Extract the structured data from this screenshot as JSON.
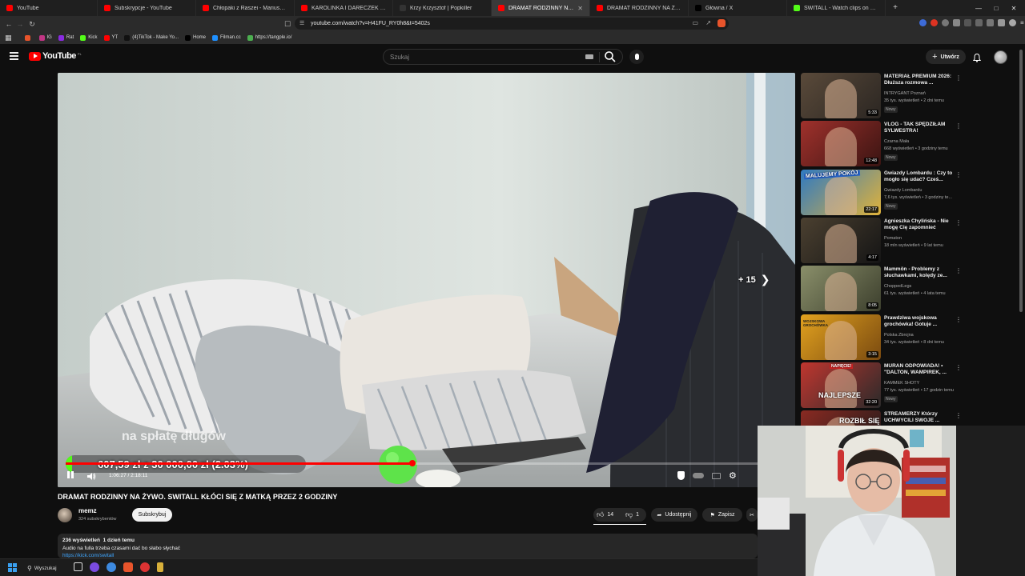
{
  "tabs": [
    {
      "label": "YouTube",
      "color": "#ff0000",
      "active": false
    },
    {
      "label": "Subskrypcje - YouTube",
      "color": "#ff0000",
      "active": false
    },
    {
      "label": "Chłopaki z Raszei - Mariusz wymyśli...",
      "color": "#ff0000",
      "active": false
    },
    {
      "label": "KAROLINKA I DARECZEK - YouTube",
      "color": "#ff0000",
      "active": false
    },
    {
      "label": "Krzy Krzysztof | Popkiller",
      "color": "#333333",
      "active": false
    },
    {
      "label": "DRAMAT RODZINNY NA ŻYW...",
      "color": "#ff0000",
      "active": true
    },
    {
      "label": "DRAMAT RODZINNY NA ŻYWO. SWI...",
      "color": "#ff0000",
      "active": false
    },
    {
      "label": "Główna / X",
      "color": "#000000",
      "active": false
    },
    {
      "label": "SWITALL - Watch clips on Kick",
      "color": "#53fc18",
      "active": false
    }
  ],
  "address": {
    "url": "youtube.com/watch?v=H41FU_RY0h8&t=5402s"
  },
  "bookmarks": [
    {
      "label": "",
      "color": "#e8542b"
    },
    {
      "label": "IG",
      "color": "#c13584"
    },
    {
      "label": "Rat",
      "color": "#8a2be2"
    },
    {
      "label": "Kick",
      "color": "#53fc18"
    },
    {
      "label": "YT",
      "color": "#ff0000"
    },
    {
      "label": "(4)TikTok - Make Yo...",
      "color": "#111111"
    },
    {
      "label": "Home",
      "color": "#000000"
    },
    {
      "label": "Filman.cc",
      "color": "#1e90ff"
    },
    {
      "label": "https://tangple.io/",
      "color": "#4caf50"
    }
  ],
  "youtube": {
    "logo": "YouTube",
    "region": "PL",
    "search_placeholder": "Szukaj",
    "create_label": "Utwórz"
  },
  "player": {
    "caption": "na spłatę długów",
    "donation_text": "607,59 zł z 30 000,00 zł (2.03%)",
    "time": "1:06:27 / 2:18:11",
    "skip_label": "+ 15",
    "progress": 0.481
  },
  "video": {
    "title": "DRAMAT RODZINNY NA ŻYWO. SWITALL KŁÓCI SIĘ Z MATKĄ PRZEZ 2 GODZINY",
    "channel": "memz",
    "subscribers": "324 subskrybentów",
    "subscribe_label": "Subskrybuj",
    "likes": "14",
    "dislikes": "1",
    "share_label": "Udostępnij",
    "save_label": "Zapisz",
    "views_date": "236 wyświetleń  1 dzień temu",
    "description": "Audio na fulla trzeba czasami dać bo słabo słychać",
    "link": "https://kick.com/switall"
  },
  "recommendations": [
    {
      "title": "MATERIAŁ PREMIUM 2026: Dłuższa rozmowa ...",
      "channel": "INTRYGANT Poznań",
      "meta": "35 tys. wyświetleń • 2 dni temu",
      "duration": "5:33",
      "badge": "Nowy",
      "bg1": "#5a4a3a",
      "bg2": "#2b2622"
    },
    {
      "title": "VLOG - TAK SPĘDZIŁAM SYLWESTRA!",
      "channel": "Czarna Mała",
      "meta": "668 wyświetleń • 3 godziny temu",
      "duration": "12:48",
      "badge": "Nowy",
      "bg1": "#a0312c",
      "bg2": "#3a1412"
    },
    {
      "title": "Gwiazdy Lombardu : Czy to mogło się udać? Cześ...",
      "channel": "Gwiazdy Lombardu",
      "meta": "7,6 tys. wyświetleń • 3 godziny te...",
      "duration": "22:17",
      "badge": "Nowy",
      "bg1": "#2f7ac2",
      "bg2": "#e0b23a"
    },
    {
      "title": "Agnieszka Chylińska - Nie mogę Cię zapomnieć",
      "channel": "Pomaton",
      "meta": "18 mln wyświetleń • 9 lat temu",
      "duration": "4:17",
      "badge": "",
      "bg1": "#4b4030",
      "bg2": "#151515"
    },
    {
      "title": "Mammön - Problemy z słuchawkami, kolędy ze...",
      "channel": "ChoppedLegs",
      "meta": "61 tys. wyświetleń • 4 lata temu",
      "duration": "8:05",
      "badge": "",
      "bg1": "#8a8f6a",
      "bg2": "#3c3f2d"
    },
    {
      "title": "Prawdziwa wojskowa grochówka! Gotuje ...",
      "channel": "Polska Zbrojna",
      "meta": "34 tys. wyświetleń • 8 dni temu",
      "duration": "3:15",
      "badge": "",
      "bg1": "#e2a21f",
      "bg2": "#7a4a10"
    },
    {
      "title": "MURAN ODPOWIADA! • \"DALTON, WAMPIREK, ...",
      "channel": "KAMMEK SHOTY",
      "meta": "77 tys. wyświetleń • 17 godzin temu",
      "duration": "32:20",
      "badge": "Nowy",
      "bg1": "#c0362f",
      "bg2": "#2a2a2a"
    },
    {
      "title": "STREAMERZY Którzy UCHWYCILI SWOJE ...",
      "channel": "",
      "meta": "",
      "duration": "",
      "badge": "",
      "bg1": "#8a2a22",
      "bg2": "#1a1a1a"
    }
  ],
  "rec_thumb_text": {
    "r2": "MALUJEMY POKÓJ",
    "r5": "WOJSKOWA GROCHÓWKA",
    "r6top": "NAPIĘCIE!",
    "r6bot": "NAJLEPSZE",
    "r7": "ROZBIŁ SIĘ"
  },
  "taskbar": {
    "search_label": "Wyszukaj"
  }
}
